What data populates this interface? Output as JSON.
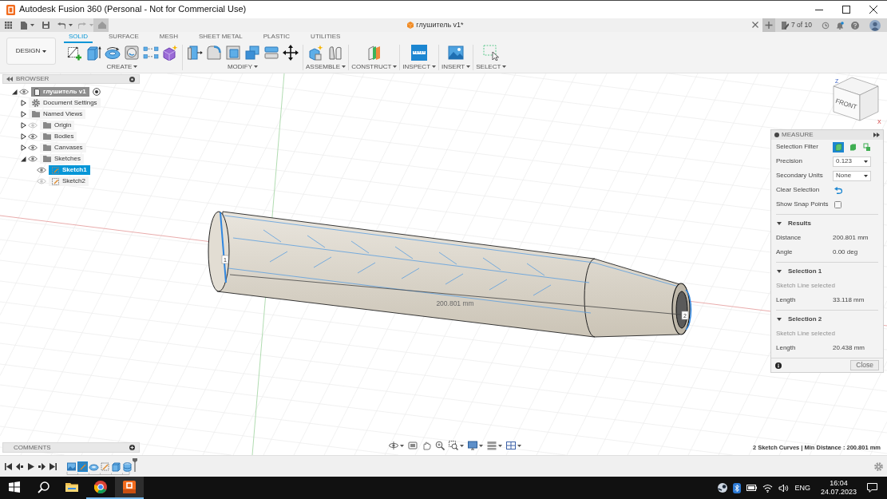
{
  "window": {
    "title": "Autodesk Fusion 360 (Personal - Not for Commercial Use)"
  },
  "quick_access": {
    "document_tab": "глушитель v1*",
    "job_status": "7 of 10"
  },
  "toolbar": {
    "workspace": "DESIGN",
    "tabs": [
      {
        "label": "SOLID",
        "selected": true
      },
      {
        "label": "SURFACE",
        "selected": false
      },
      {
        "label": "MESH",
        "selected": false
      },
      {
        "label": "SHEET METAL",
        "selected": false
      },
      {
        "label": "PLASTIC",
        "selected": false
      },
      {
        "label": "UTILITIES",
        "selected": false
      }
    ],
    "groups": [
      {
        "label": "CREATE",
        "tools": [
          {
            "kind": "sketch"
          },
          {
            "kind": "extrude"
          },
          {
            "kind": "revolve"
          },
          {
            "kind": "hole"
          },
          {
            "kind": "pattern"
          },
          {
            "kind": "form"
          }
        ]
      },
      {
        "label": "MODIFY",
        "tools": [
          {
            "kind": "presspull"
          },
          {
            "kind": "fillet"
          },
          {
            "kind": "shell"
          },
          {
            "kind": "combine"
          },
          {
            "kind": "offset"
          },
          {
            "kind": "move"
          }
        ]
      },
      {
        "label": "ASSEMBLE",
        "tools": [
          {
            "kind": "component"
          },
          {
            "kind": "joint"
          }
        ]
      },
      {
        "label": "CONSTRUCT",
        "tools": [
          {
            "kind": "plane"
          }
        ]
      },
      {
        "label": "INSPECT",
        "tools": [
          {
            "kind": "measure"
          }
        ]
      },
      {
        "label": "INSERT",
        "tools": [
          {
            "kind": "image"
          }
        ]
      },
      {
        "label": "SELECT",
        "tools": [
          {
            "kind": "select"
          }
        ]
      }
    ]
  },
  "browser": {
    "title": "BROWSER",
    "tree": [
      {
        "kind": "component",
        "label": "глушитель v1",
        "expanded": true,
        "visible": true,
        "selected": false,
        "children": [
          {
            "kind": "settings",
            "label": "Document Settings",
            "expanded": false,
            "selected": false
          },
          {
            "kind": "folder",
            "label": "Named Views",
            "expanded": false,
            "selected": false
          },
          {
            "kind": "folder",
            "label": "Origin",
            "expanded": false,
            "visible": false,
            "selected": false
          },
          {
            "kind": "folder",
            "label": "Bodies",
            "expanded": false,
            "visible": true,
            "selected": false
          },
          {
            "kind": "folder",
            "label": "Canvases",
            "expanded": false,
            "visible": true,
            "selected": false
          },
          {
            "kind": "folder",
            "label": "Sketches",
            "expanded": true,
            "visible": true,
            "selected": false,
            "children": [
              {
                "kind": "sketch",
                "label": "Sketch1",
                "visible": true,
                "selected": true
              },
              {
                "kind": "sketch",
                "label": "Sketch2",
                "visible": false,
                "selected": false
              }
            ]
          }
        ]
      }
    ]
  },
  "viewport": {
    "dimension_label": "200.801 mm",
    "point_markers": [
      "1",
      "2"
    ],
    "view_cube": {
      "face_label": "FRONT",
      "axis_labels": [
        "Z",
        "X"
      ]
    }
  },
  "measure_panel": {
    "title": "MEASURE",
    "settings": [
      {
        "kind": "filter",
        "label": "Selection Filter",
        "options": [
          {
            "selected": true
          },
          {
            "selected": false
          },
          {
            "selected": false
          }
        ]
      },
      {
        "kind": "dropdown",
        "label": "Precision",
        "value": "0.123"
      },
      {
        "kind": "dropdown",
        "label": "Secondary Units",
        "value": "None"
      },
      {
        "kind": "action",
        "label": "Clear Selection"
      },
      {
        "kind": "checkbox",
        "label": "Show Snap Points",
        "checked": false
      }
    ],
    "sections": [
      {
        "title": "Results",
        "expanded": true,
        "rows": [
          {
            "label": "Distance",
            "value": "200.801 mm"
          },
          {
            "label": "Angle",
            "value": "0.00 deg"
          }
        ]
      },
      {
        "title": "Selection 1",
        "expanded": true,
        "note": "Sketch Line selected",
        "rows": [
          {
            "label": "Length",
            "value": "33.118 mm"
          }
        ]
      },
      {
        "title": "Selection 2",
        "expanded": true,
        "note": "Sketch Line selected",
        "rows": [
          {
            "label": "Length",
            "value": "20.438 mm"
          }
        ]
      }
    ],
    "close_button": "Close"
  },
  "comments": {
    "title": "COMMENTS"
  },
  "status_bar": {
    "text": "2 Sketch Curves | Min Distance : 200.801 mm"
  },
  "timeline": {
    "features": [
      {
        "kind": "canvas",
        "selected": false
      },
      {
        "kind": "sketch",
        "selected": true
      },
      {
        "kind": "revolve",
        "selected": false
      },
      {
        "kind": "sketch",
        "selected": false
      },
      {
        "kind": "extrude",
        "selected": false
      },
      {
        "kind": "cylinder",
        "selected": false
      }
    ]
  },
  "taskbar": {
    "apps": [
      {
        "kind": "explorer",
        "running": false,
        "active": false
      },
      {
        "kind": "browser",
        "running": true,
        "active": false
      },
      {
        "kind": "fusion",
        "running": true,
        "active": true
      }
    ],
    "tray": {
      "language": "ENG",
      "time": "16:04",
      "date": "24.07.2023"
    }
  }
}
